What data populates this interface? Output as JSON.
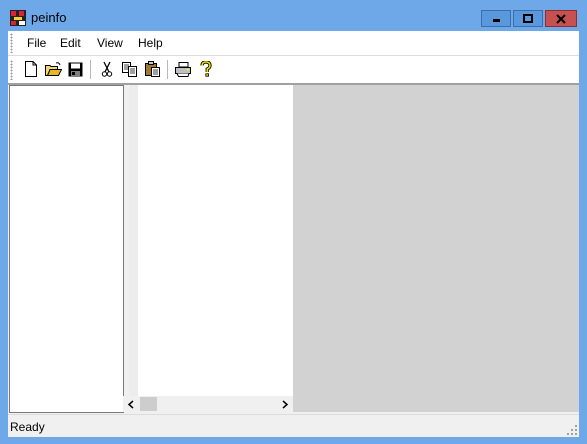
{
  "window": {
    "title": "peinfo"
  },
  "menu": {
    "file": "File",
    "edit": "Edit",
    "view": "View",
    "help": "Help"
  },
  "toolbar": {
    "buttons": [
      "new-icon",
      "open-icon",
      "save-icon",
      "cut-icon",
      "copy-icon",
      "paste-icon",
      "print-icon",
      "help-icon"
    ]
  },
  "status": {
    "text": "Ready"
  },
  "colors": {
    "title_bar": "#6fa8e8",
    "close_button": "#c75050",
    "right_pane": "#d2d2d2"
  }
}
